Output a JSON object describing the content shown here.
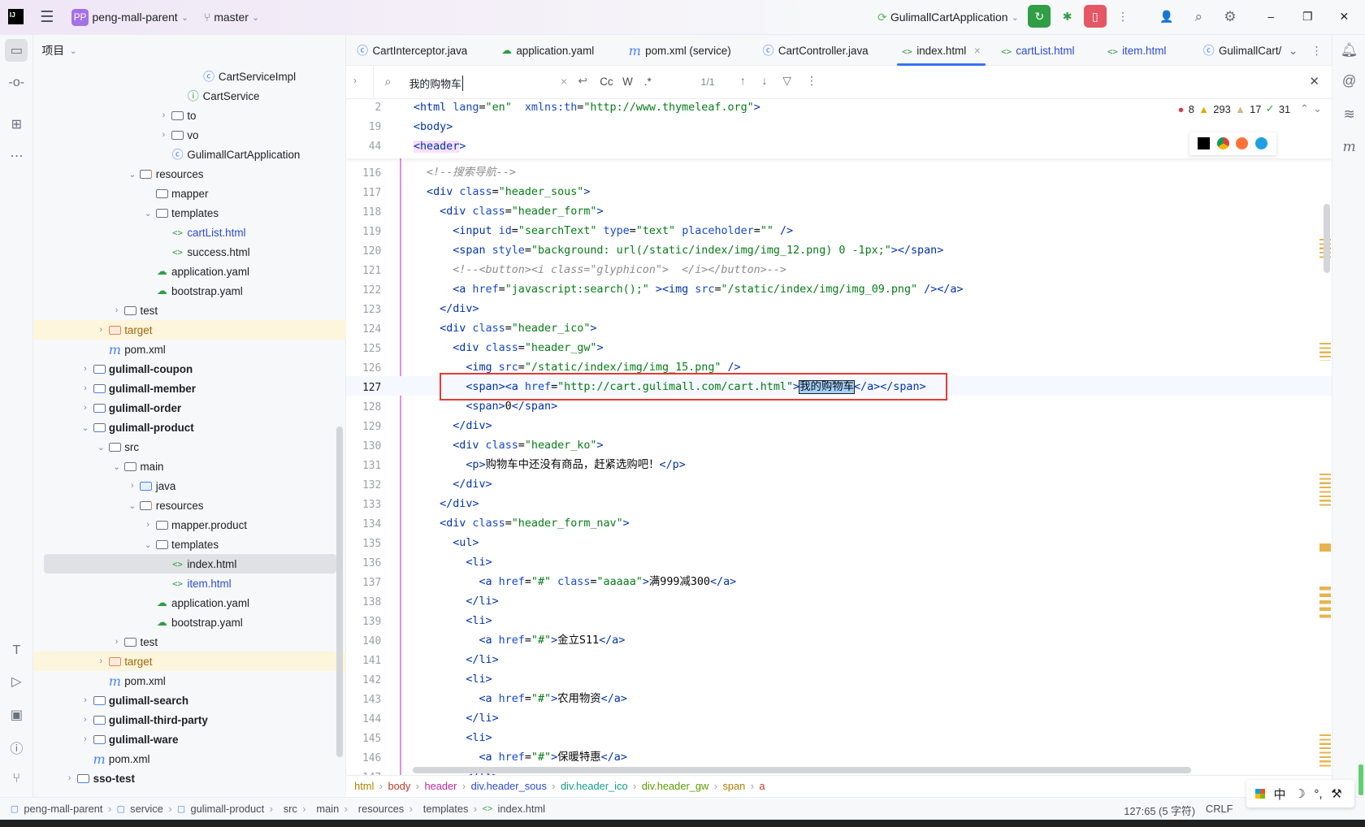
{
  "titlebar": {
    "project_badge": "PP",
    "project": "peng-mall-parent",
    "branch": "master",
    "run_config": "GulimallCartApplication",
    "window_controls": [
      "minimize-icon",
      "restore-icon",
      "close-icon"
    ]
  },
  "project_panel": {
    "title": "项目",
    "items": [
      {
        "label": "CartServiceImpl",
        "depth": 8,
        "icon": "class",
        "state": "leaf"
      },
      {
        "label": "CartService",
        "depth": 7,
        "icon": "interface",
        "state": "leaf"
      },
      {
        "label": "to",
        "depth": 6,
        "icon": "package",
        "state": "collapsed"
      },
      {
        "label": "vo",
        "depth": 6,
        "icon": "package",
        "state": "collapsed"
      },
      {
        "label": "GulimallCartApplication",
        "depth": 6,
        "icon": "spring-app",
        "state": "leaf"
      },
      {
        "label": "resources",
        "depth": 4,
        "icon": "resources-folder",
        "state": "expanded"
      },
      {
        "label": "mapper",
        "depth": 5,
        "icon": "folder",
        "state": "leaf"
      },
      {
        "label": "templates",
        "depth": 5,
        "icon": "folder",
        "state": "expanded"
      },
      {
        "label": "cartList.html",
        "depth": 6,
        "icon": "html",
        "state": "leaf",
        "color": "#2a4bd7"
      },
      {
        "label": "success.html",
        "depth": 6,
        "icon": "html",
        "state": "leaf"
      },
      {
        "label": "application.yaml",
        "depth": 5,
        "icon": "yaml",
        "state": "leaf"
      },
      {
        "label": "bootstrap.yaml",
        "depth": 5,
        "icon": "yaml",
        "state": "leaf"
      },
      {
        "label": "test",
        "depth": 3,
        "icon": "folder",
        "state": "collapsed"
      },
      {
        "label": "target",
        "depth": 2,
        "icon": "excluded-folder",
        "state": "collapsed",
        "highlight": true,
        "color": "#a0650a"
      },
      {
        "label": "pom.xml",
        "depth": 2,
        "icon": "maven",
        "state": "leaf"
      },
      {
        "label": "gulimall-coupon",
        "depth": 1,
        "icon": "module",
        "state": "collapsed",
        "bold": true
      },
      {
        "label": "gulimall-member",
        "depth": 1,
        "icon": "module",
        "state": "collapsed",
        "bold": true
      },
      {
        "label": "gulimall-order",
        "depth": 1,
        "icon": "module",
        "state": "collapsed",
        "bold": true
      },
      {
        "label": "gulimall-product",
        "depth": 1,
        "icon": "module",
        "state": "expanded",
        "bold": true
      },
      {
        "label": "src",
        "depth": 2,
        "icon": "folder",
        "state": "expanded"
      },
      {
        "label": "main",
        "depth": 3,
        "icon": "folder",
        "state": "expanded"
      },
      {
        "label": "java",
        "depth": 4,
        "icon": "source-folder",
        "state": "collapsed"
      },
      {
        "label": "resources",
        "depth": 4,
        "icon": "resources-folder",
        "state": "expanded"
      },
      {
        "label": "mapper.product",
        "depth": 5,
        "icon": "folder",
        "state": "collapsed"
      },
      {
        "label": "templates",
        "depth": 5,
        "icon": "folder",
        "state": "expanded"
      },
      {
        "label": "index.html",
        "depth": 6,
        "icon": "html",
        "state": "leaf",
        "selected": true
      },
      {
        "label": "item.html",
        "depth": 6,
        "icon": "html",
        "state": "leaf",
        "color": "#2a4bd7"
      },
      {
        "label": "application.yaml",
        "depth": 5,
        "icon": "yaml",
        "state": "leaf"
      },
      {
        "label": "bootstrap.yaml",
        "depth": 5,
        "icon": "yaml",
        "state": "leaf"
      },
      {
        "label": "test",
        "depth": 3,
        "icon": "folder",
        "state": "collapsed"
      },
      {
        "label": "target",
        "depth": 2,
        "icon": "excluded-folder",
        "state": "collapsed",
        "highlight": true,
        "color": "#a0650a"
      },
      {
        "label": "pom.xml",
        "depth": 2,
        "icon": "maven",
        "state": "leaf"
      },
      {
        "label": "gulimall-search",
        "depth": 1,
        "icon": "module",
        "state": "collapsed",
        "bold": true
      },
      {
        "label": "gulimall-third-party",
        "depth": 1,
        "icon": "module",
        "state": "collapsed",
        "bold": true
      },
      {
        "label": "gulimall-ware",
        "depth": 1,
        "icon": "module",
        "state": "collapsed",
        "bold": true
      },
      {
        "label": "pom.xml",
        "depth": 1,
        "icon": "maven",
        "state": "leaf"
      },
      {
        "label": "sso-test",
        "depth": 0,
        "icon": "module",
        "state": "collapsed",
        "bold": true
      }
    ]
  },
  "tabs": [
    {
      "label": "CartInterceptor.java",
      "icon": "class"
    },
    {
      "label": "application.yaml",
      "icon": "yaml"
    },
    {
      "label": "pom.xml (service)",
      "icon": "maven"
    },
    {
      "label": "CartController.java",
      "icon": "class"
    },
    {
      "label": "index.html",
      "icon": "html",
      "active": true
    },
    {
      "label": "cartList.html",
      "icon": "html",
      "color": "#2a4bd7"
    },
    {
      "label": "item.html",
      "icon": "html",
      "color": "#2a4bd7"
    },
    {
      "label": "GulimallCart/",
      "icon": "spring-app"
    }
  ],
  "search": {
    "query": "我的购物车",
    "match_count": "1/1",
    "options": [
      "Cc",
      "W",
      ".*"
    ]
  },
  "inspections": {
    "errors": "8",
    "warnings": "293",
    "weak_warnings": "17",
    "ok": "31"
  },
  "sticky_lines": [
    {
      "num": "2",
      "text": "<html lang=\"en\"  xmlns:th=\"http://www.thymeleaf.org\">"
    },
    {
      "num": "19",
      "text": "<body>"
    },
    {
      "num": "44",
      "text": "<header>"
    }
  ],
  "code_lines": [
    {
      "num": "116",
      "text": "  <!--搜索导航-->"
    },
    {
      "num": "117",
      "text": "  <div class=\"header_sous\">"
    },
    {
      "num": "118",
      "text": "    <div class=\"header_form\">"
    },
    {
      "num": "119",
      "text": "      <input id=\"searchText\" type=\"text\" placeholder=\"\" />"
    },
    {
      "num": "120",
      "text": "      <span style=\"background: url(/static/index/img/img_12.png) 0 -1px;\"></span>"
    },
    {
      "num": "121",
      "text": "      <!--<button><i class=\"glyphicon\">  </i></button>-->"
    },
    {
      "num": "122",
      "text": "      <a href=\"javascript:search();\" ><img src=\"/static/index/img/img_09.png\" /></a>"
    },
    {
      "num": "123",
      "text": "    </div>"
    },
    {
      "num": "124",
      "text": "    <div class=\"header_ico\">"
    },
    {
      "num": "125",
      "text": "      <div class=\"header_gw\">"
    },
    {
      "num": "126",
      "text": "        <img src=\"/static/index/img/img_15.png\" />"
    },
    {
      "num": "127",
      "text": "        <span><a href=\"http://cart.gulimall.com/cart.html\">我的购物车</a></span>",
      "current": true
    },
    {
      "num": "128",
      "text": "        <span>0</span>"
    },
    {
      "num": "129",
      "text": "      </div>"
    },
    {
      "num": "130",
      "text": "      <div class=\"header_ko\">"
    },
    {
      "num": "131",
      "text": "        <p>购物车中还没有商品，赶紧选购吧！</p>"
    },
    {
      "num": "132",
      "text": "      </div>"
    },
    {
      "num": "133",
      "text": "    </div>"
    },
    {
      "num": "134",
      "text": "    <div class=\"header_form_nav\">"
    },
    {
      "num": "135",
      "text": "      <ul>"
    },
    {
      "num": "136",
      "text": "        <li>"
    },
    {
      "num": "137",
      "text": "          <a href=\"#\" class=\"aaaaa\">满999减300</a>"
    },
    {
      "num": "138",
      "text": "        </li>"
    },
    {
      "num": "139",
      "text": "        <li>"
    },
    {
      "num": "140",
      "text": "          <a href=\"#\">金立S11</a>"
    },
    {
      "num": "141",
      "text": "        </li>"
    },
    {
      "num": "142",
      "text": "        <li>"
    },
    {
      "num": "143",
      "text": "          <a href=\"#\">农用物资</a>"
    },
    {
      "num": "144",
      "text": "        </li>"
    },
    {
      "num": "145",
      "text": "        <li>"
    },
    {
      "num": "146",
      "text": "          <a href=\"#\">保暖特惠</a>"
    },
    {
      "num": "147",
      "text": "        </li>"
    }
  ],
  "editor_breadcrumb": [
    {
      "label": "html",
      "color": "#b08000"
    },
    {
      "label": "body",
      "color": "#c0392b"
    },
    {
      "label": "header",
      "color": "#c026a0"
    },
    {
      "label": "div.header_sous",
      "color": "#2a4bd7"
    },
    {
      "label": "div.header_ico",
      "color": "#16a085"
    },
    {
      "label": "div.header_gw",
      "color": "#5b9b00"
    },
    {
      "label": "span",
      "color": "#b08000"
    },
    {
      "label": "a",
      "color": "#c0392b"
    }
  ],
  "status": {
    "path": [
      "peng-mall-parent",
      "service",
      "gulimall-product",
      "src",
      "main",
      "resources",
      "templates",
      "index.html"
    ],
    "position": "127:65 (5 字符)",
    "line_ending": "CRLF"
  },
  "ime": {
    "mode": "中"
  },
  "colors": {
    "accent": "#3574f0",
    "run_green": "#2f9e44",
    "record_red": "#e55765",
    "search_box": "#e53935"
  }
}
